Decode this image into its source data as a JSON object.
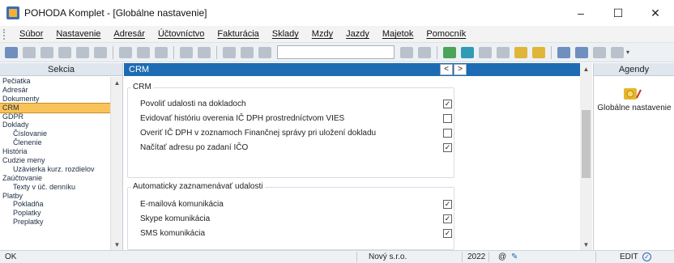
{
  "window": {
    "title": "POHODA Komplet - [Globálne nastavenie]",
    "controls": {
      "minimize": "–",
      "maximize": "☐",
      "close": "✕"
    }
  },
  "menu": [
    "Súbor",
    "Nastavenie",
    "Adresár",
    "Účtovníctvo",
    "Fakturácia",
    "Sklady",
    "Mzdy",
    "Jazdy",
    "Majetok",
    "Pomocník"
  ],
  "left_panel": {
    "header": "Sekcia",
    "items": [
      {
        "label": "Pečiatka",
        "sub": false,
        "selected": false
      },
      {
        "label": "Adresár",
        "sub": false,
        "selected": false
      },
      {
        "label": "Dokumenty",
        "sub": false,
        "selected": false
      },
      {
        "label": "CRM",
        "sub": false,
        "selected": true
      },
      {
        "label": "GDPR",
        "sub": false,
        "selected": false
      },
      {
        "label": "Doklady",
        "sub": false,
        "selected": false
      },
      {
        "label": "Číslovanie",
        "sub": true,
        "selected": false
      },
      {
        "label": "Členenie",
        "sub": true,
        "selected": false
      },
      {
        "label": "História",
        "sub": false,
        "selected": false
      },
      {
        "label": "Cudzie meny",
        "sub": false,
        "selected": false
      },
      {
        "label": "Uzávierka kurz. rozdielov",
        "sub": true,
        "selected": false
      },
      {
        "label": "Zaúčtovanie",
        "sub": false,
        "selected": false
      },
      {
        "label": "Texty v úč. denníku",
        "sub": true,
        "selected": false
      },
      {
        "label": "Platby",
        "sub": false,
        "selected": false
      },
      {
        "label": "Pokladňa",
        "sub": true,
        "selected": false
      },
      {
        "label": "Poplatky",
        "sub": true,
        "selected": false
      },
      {
        "label": "Preplatky",
        "sub": true,
        "selected": false
      }
    ]
  },
  "main": {
    "header": "CRM",
    "nav_prev": "<",
    "nav_next": ">",
    "group1": {
      "title": "CRM",
      "rows": [
        {
          "label": "Povoliť udalosti na dokladoch",
          "checked": true
        },
        {
          "label": "Evidovať históriu overenia IČ DPH prostredníctvom VIES",
          "checked": false
        },
        {
          "label": "Overiť IČ DPH v zoznamoch Finančnej správy pri uložení dokladu",
          "checked": false
        },
        {
          "label": "Načítať adresu po zadaní IČO",
          "checked": true
        }
      ]
    },
    "group2": {
      "title": "Automaticky zaznamenávať udalosti",
      "rows": [
        {
          "label": "E-mailová komunikácia",
          "checked": true
        },
        {
          "label": "Skype komunikácia",
          "checked": true
        },
        {
          "label": "SMS komunikácia",
          "checked": true
        }
      ]
    }
  },
  "right_panel": {
    "header": "Agendy",
    "agenda_label": "Globálne nastavenie"
  },
  "status": {
    "left": "OK",
    "company": "Nový s.r.o.",
    "year": "2022",
    "at": "@",
    "mode": "EDIT",
    "mode_check": "✓"
  },
  "colors": {
    "accent": "#1d6bb3",
    "selected": "#f9c35a"
  }
}
